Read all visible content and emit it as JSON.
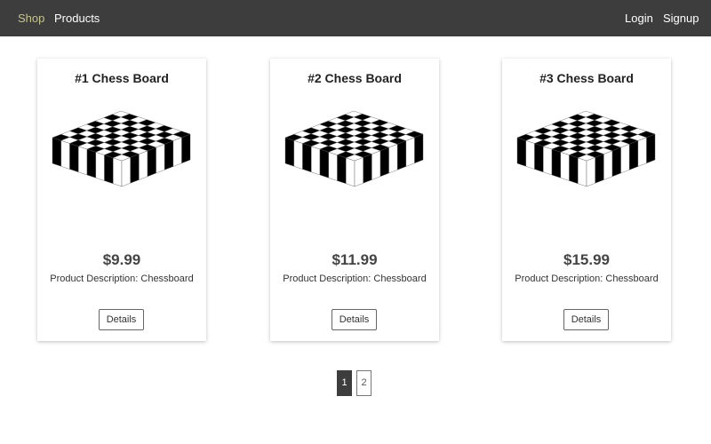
{
  "navbar": {
    "brand": "Shop",
    "products": "Products",
    "login": "Login",
    "signup": "Signup"
  },
  "products": [
    {
      "title": "#1 Chess Board",
      "price": "$9.99",
      "description": "Product Description: Chessboard",
      "details_label": "Details",
      "image": "chessboard-image"
    },
    {
      "title": "#2 Chess Board",
      "price": "$11.99",
      "description": "Product Description: Chessboard",
      "details_label": "Details",
      "image": "chessboard-image"
    },
    {
      "title": "#3 Chess Board",
      "price": "$15.99",
      "description": "Product Description: Chessboard",
      "details_label": "Details",
      "image": "chessboard-image"
    }
  ],
  "pagination": {
    "pages": [
      "1",
      "2"
    ],
    "current": "1"
  },
  "colors": {
    "navbar_bg": "#3d3d3d",
    "brand": "#c8c490",
    "active_page_bg": "#3d3d3d"
  }
}
